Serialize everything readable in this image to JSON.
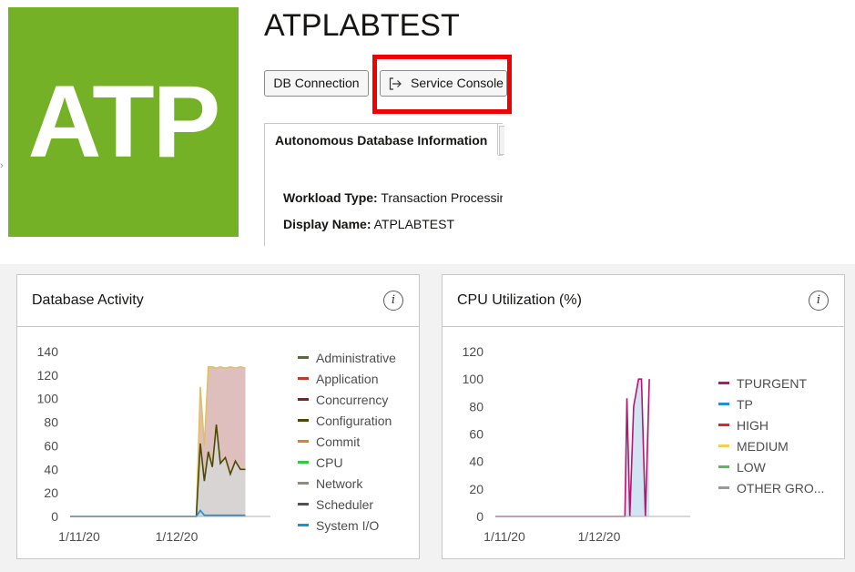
{
  "header": {
    "logo_text": "ATP",
    "title": "ATPLABTEST",
    "buttons": {
      "db_connection": "DB Connection",
      "service_console": "Service Console"
    },
    "tab": "Autonomous Database Information",
    "fields": [
      {
        "label": "Workload Type:",
        "value": "Transaction Processing"
      },
      {
        "label": "Display Name:",
        "value": "ATPLABTEST"
      }
    ],
    "highlight_color": "#f00000",
    "logo_color": "#75b126"
  },
  "icons": {
    "service_console": "external-link-icon",
    "info": "info-icon"
  },
  "panels": {
    "activity": {
      "title": "Database Activity",
      "info_glyph": "i"
    },
    "cpu": {
      "title": "CPU Utilization (%)",
      "info_glyph": "i"
    }
  },
  "chart_data": [
    {
      "type": "area",
      "title": "Database Activity",
      "x_ticks": [
        "1/11/20",
        "1/12/20"
      ],
      "y_ticks": [
        "0",
        "20",
        "40",
        "60",
        "80",
        "100",
        "120",
        "140"
      ],
      "ylim": [
        0,
        140
      ],
      "grid": false,
      "legend_position": "right",
      "legend": [
        {
          "name": "Administrative",
          "color": "#556b2f"
        },
        {
          "name": "Application",
          "color": "#c0392b"
        },
        {
          "name": "Concurrency",
          "color": "#8b1a1a"
        },
        {
          "name": "Configuration",
          "color": "#4a4a00"
        },
        {
          "name": "Commit",
          "color": "#e67e22"
        },
        {
          "name": "CPU",
          "color": "#2ecc40"
        },
        {
          "name": "Network",
          "color": "#a0896b"
        },
        {
          "name": "Scheduler",
          "color": "#505050"
        },
        {
          "name": "System I/O",
          "color": "#1f8fd6"
        }
      ],
      "x": [
        0,
        0.2,
        0.4,
        0.6,
        0.8,
        1.0,
        1.1,
        1.15,
        1.18,
        1.22,
        1.26,
        1.3,
        1.34,
        1.38,
        1.42,
        1.46,
        1.5,
        1.55,
        1.6,
        1.65,
        1.7,
        1.75
      ],
      "series": [
        {
          "name": "Network",
          "fill": "#d9b3b3",
          "stroke": "#e0c060",
          "values": [
            0,
            0,
            0,
            0,
            0,
            0,
            0,
            0,
            0,
            0,
            0,
            110,
            60,
            127,
            127,
            126,
            127,
            126,
            127,
            126,
            127,
            126
          ]
        },
        {
          "name": "Concurrency",
          "fill": "#d8d8d8",
          "stroke": "#4a4a00",
          "values": [
            0,
            0,
            0,
            0,
            0,
            0,
            0,
            0,
            0,
            0,
            0,
            62,
            30,
            55,
            42,
            78,
            45,
            50,
            36,
            47,
            40,
            40
          ]
        },
        {
          "name": "System I/O",
          "fill": "none",
          "stroke": "#1f8fd6",
          "values": [
            0,
            0,
            0,
            0,
            0,
            0,
            0,
            0,
            0,
            0,
            0,
            5,
            1,
            1,
            1,
            1,
            1,
            1,
            1,
            1,
            1,
            1
          ]
        }
      ]
    },
    {
      "type": "area",
      "title": "CPU Utilization (%)",
      "x_ticks": [
        "1/11/20",
        "1/12/20"
      ],
      "y_ticks": [
        "0",
        "20",
        "40",
        "60",
        "80",
        "100",
        "120"
      ],
      "ylim": [
        0,
        120
      ],
      "grid": false,
      "legend_position": "right",
      "legend": [
        {
          "name": "TPURGENT",
          "color": "#b5176d"
        },
        {
          "name": "TP",
          "color": "#1f8fd6"
        },
        {
          "name": "HIGH",
          "color": "#e8222a"
        },
        {
          "name": "MEDIUM",
          "color": "#f2d05a"
        },
        {
          "name": "LOW",
          "color": "#5cb85c"
        },
        {
          "name": "OTHER GRO...",
          "color": "#999999"
        }
      ],
      "x": [
        0,
        0.2,
        0.4,
        0.6,
        0.8,
        1.0,
        1.1,
        1.2,
        1.28,
        1.33,
        1.35,
        1.38,
        1.42,
        1.47,
        1.5,
        1.54,
        1.58
      ],
      "series": [
        {
          "name": "TPURGENT",
          "fill": "#c9dff2",
          "stroke": "#b5176d",
          "values": [
            0,
            0,
            0,
            0,
            0,
            0,
            0,
            0,
            0,
            0,
            86,
            0,
            80,
            100,
            100,
            0,
            100
          ]
        }
      ]
    }
  ]
}
